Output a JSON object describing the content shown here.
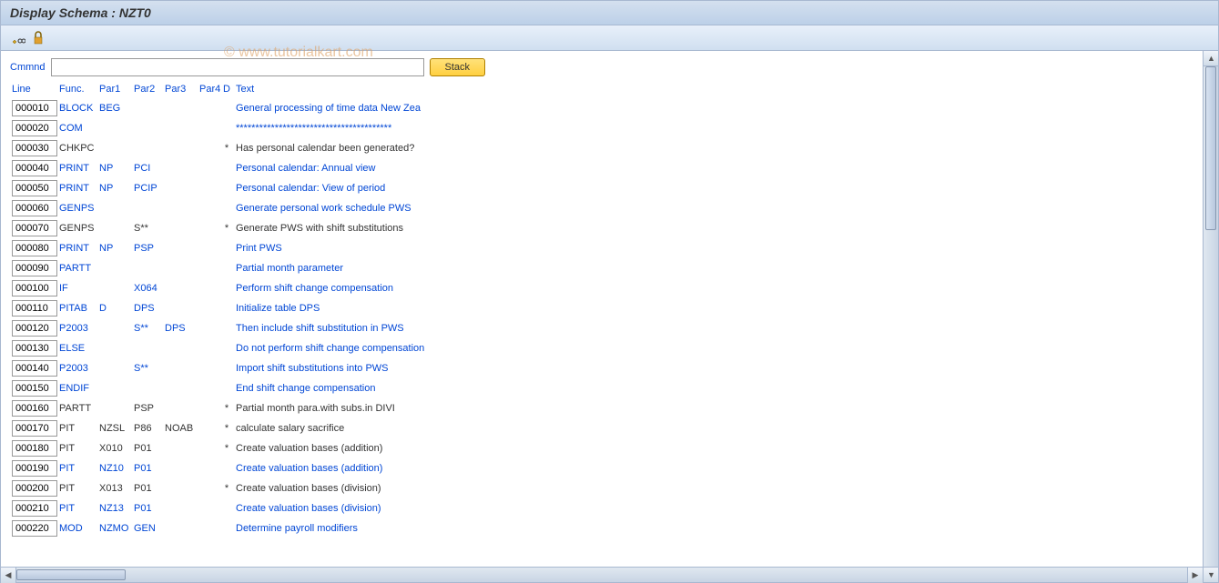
{
  "title": "Display Schema : NZT0",
  "watermark": "© www.tutorialkart.com",
  "cmmnd": {
    "label": "Cmmnd",
    "value": "",
    "stack_label": "Stack"
  },
  "headers": {
    "line": "Line",
    "func": "Func.",
    "par1": "Par1",
    "par2": "Par2",
    "par3": "Par3",
    "par4": "Par4",
    "d": "D",
    "text": "Text"
  },
  "rows": [
    {
      "line": "000010",
      "func": "BLOCK",
      "par1": "BEG",
      "par2": "",
      "par3": "",
      "par4": "",
      "d": "",
      "text": "General processing of time data New Zea",
      "blue": true
    },
    {
      "line": "000020",
      "func": "COM",
      "par1": "",
      "par2": "",
      "par3": "",
      "par4": "",
      "d": "",
      "text": "****************************************",
      "blue": true
    },
    {
      "line": "000030",
      "func": "CHKPC",
      "par1": "",
      "par2": "",
      "par3": "",
      "par4": "",
      "d": "*",
      "text": "Has personal calendar been generated?",
      "blue": false
    },
    {
      "line": "000040",
      "func": "PRINT",
      "par1": "NP",
      "par2": "PCI",
      "par3": "",
      "par4": "",
      "d": "",
      "text": "Personal calendar: Annual view",
      "blue": true
    },
    {
      "line": "000050",
      "func": "PRINT",
      "par1": "NP",
      "par2": "PCIP",
      "par3": "",
      "par4": "",
      "d": "",
      "text": "Personal calendar: View of period",
      "blue": true
    },
    {
      "line": "000060",
      "func": "GENPS",
      "par1": "",
      "par2": "",
      "par3": "",
      "par4": "",
      "d": "",
      "text": "Generate personal work schedule PWS",
      "blue": true
    },
    {
      "line": "000070",
      "func": "GENPS",
      "par1": "",
      "par2": "S**",
      "par3": "",
      "par4": "",
      "d": "*",
      "text": "Generate PWS with shift substitutions",
      "blue": false
    },
    {
      "line": "000080",
      "func": "PRINT",
      "par1": "NP",
      "par2": "PSP",
      "par3": "",
      "par4": "",
      "d": "",
      "text": "Print PWS",
      "blue": true
    },
    {
      "line": "000090",
      "func": "PARTT",
      "par1": "",
      "par2": "",
      "par3": "",
      "par4": "",
      "d": "",
      "text": "Partial month parameter",
      "blue": true
    },
    {
      "line": "000100",
      "func": "IF",
      "par1": "",
      "par2": "X064",
      "par3": "",
      "par4": "",
      "d": "",
      "text": "Perform shift change compensation",
      "blue": true
    },
    {
      "line": "000110",
      "func": "PITAB",
      "par1": "D",
      "par2": "DPS",
      "par3": "",
      "par4": "",
      "d": "",
      "text": "Initialize table DPS",
      "blue": true
    },
    {
      "line": "000120",
      "func": "P2003",
      "par1": "",
      "par2": "S**",
      "par3": "DPS",
      "par4": "",
      "d": "",
      "text": "Then include shift substitution in PWS",
      "blue": true
    },
    {
      "line": "000130",
      "func": "ELSE",
      "par1": "",
      "par2": "",
      "par3": "",
      "par4": "",
      "d": "",
      "text": "Do not perform shift change compensation",
      "blue": true
    },
    {
      "line": "000140",
      "func": "P2003",
      "par1": "",
      "par2": "S**",
      "par3": "",
      "par4": "",
      "d": "",
      "text": "Import shift substitutions into PWS",
      "blue": true
    },
    {
      "line": "000150",
      "func": "ENDIF",
      "par1": "",
      "par2": "",
      "par3": "",
      "par4": "",
      "d": "",
      "text": "End shift change compensation",
      "blue": true
    },
    {
      "line": "000160",
      "func": "PARTT",
      "par1": "",
      "par2": "PSP",
      "par3": "",
      "par4": "",
      "d": "*",
      "text": "Partial month para.with subs.in DIVI",
      "blue": false
    },
    {
      "line": "000170",
      "func": "PIT",
      "par1": "NZSL",
      "par2": "P86",
      "par3": "NOAB",
      "par4": "",
      "d": "*",
      "text": "calculate salary sacrifice",
      "blue": false
    },
    {
      "line": "000180",
      "func": "PIT",
      "par1": "X010",
      "par2": "P01",
      "par3": "",
      "par4": "",
      "d": "*",
      "text": "Create valuation bases (addition)",
      "blue": false
    },
    {
      "line": "000190",
      "func": "PIT",
      "par1": "NZ10",
      "par2": "P01",
      "par3": "",
      "par4": "",
      "d": "",
      "text": "Create valuation bases (addition)",
      "blue": true
    },
    {
      "line": "000200",
      "func": "PIT",
      "par1": "X013",
      "par2": "P01",
      "par3": "",
      "par4": "",
      "d": "*",
      "text": "Create valuation bases (division)",
      "blue": false
    },
    {
      "line": "000210",
      "func": "PIT",
      "par1": "NZ13",
      "par2": "P01",
      "par3": "",
      "par4": "",
      "d": "",
      "text": "Create valuation bases (division)",
      "blue": true
    },
    {
      "line": "000220",
      "func": "MOD",
      "par1": "NZMO",
      "par2": "GEN",
      "par3": "",
      "par4": "",
      "d": "",
      "text": "Determine payroll modifiers",
      "blue": true
    }
  ]
}
